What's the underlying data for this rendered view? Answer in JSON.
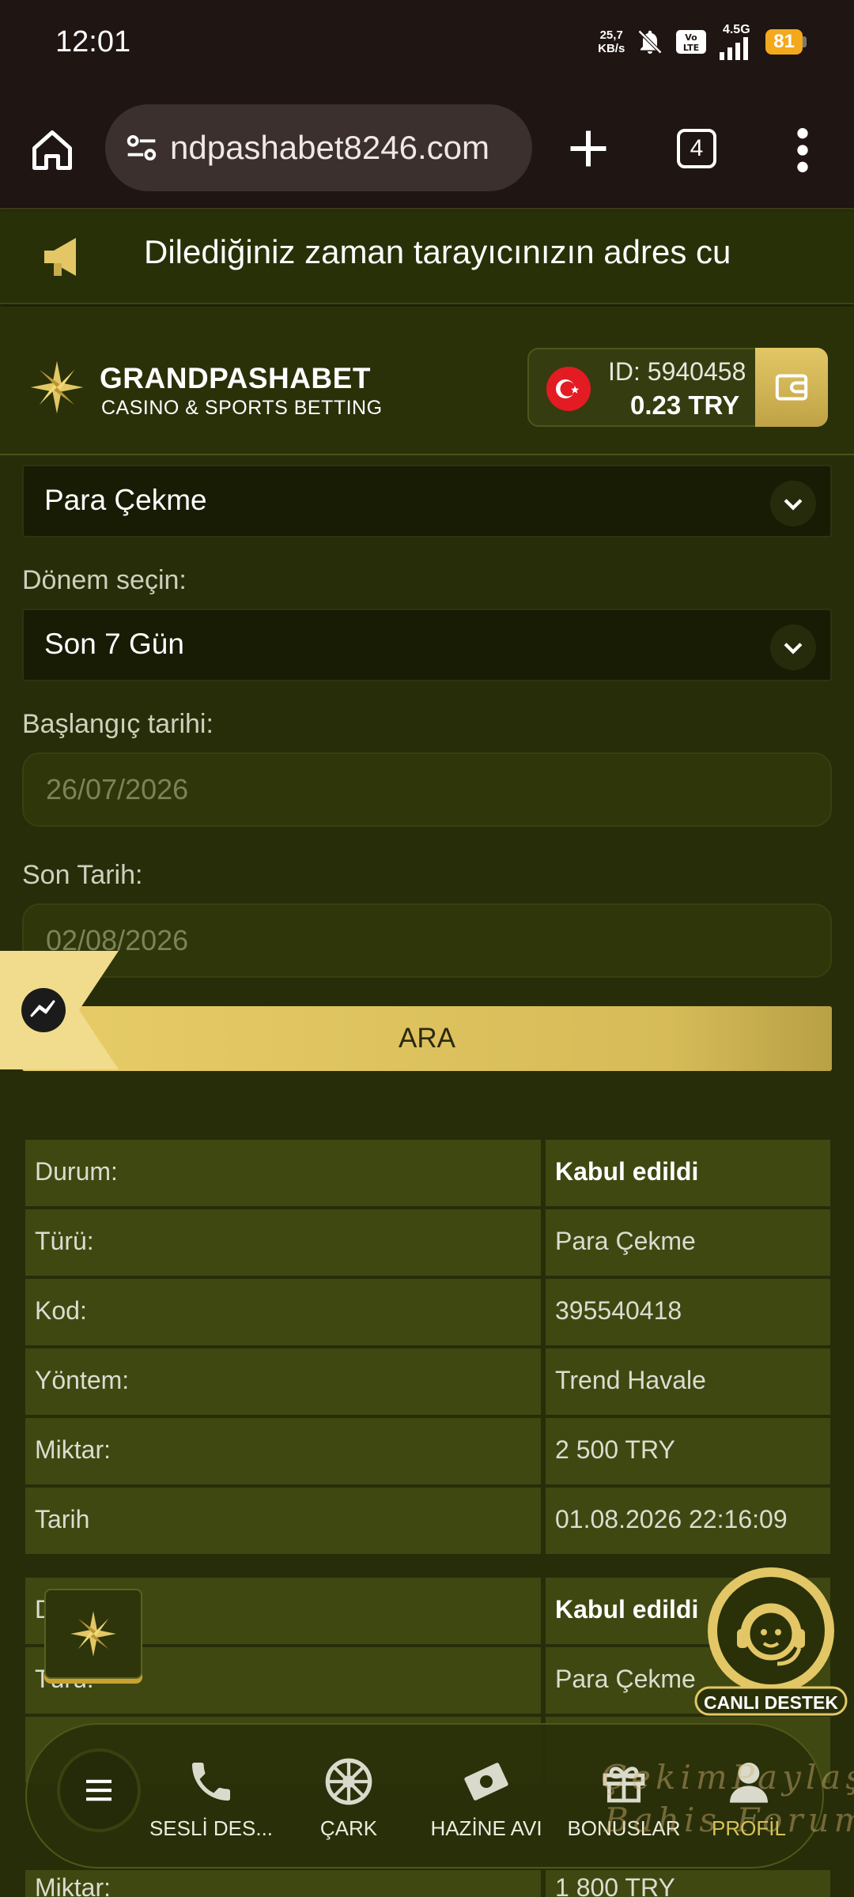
{
  "status_bar": {
    "time": "12:01",
    "net_speed_value": "25,7",
    "net_speed_unit": "KB/s",
    "network": "4.5G",
    "battery": "81"
  },
  "browser": {
    "url": "ndpashabet8246.com",
    "tab_count": "4"
  },
  "announcement": {
    "text": "Dilediğiniz zaman tarayıcınızın adres cu"
  },
  "header": {
    "brand": "GRANDPASHABET",
    "tagline": "CASINO & SPORTS BETTING",
    "account_id": "ID: 5940458",
    "balance": "0.23  TRY"
  },
  "form": {
    "type_select": "Para Çekme",
    "period_label": "Dönem seçin:",
    "period_select": "Son 7 Gün",
    "start_label": "Başlangıç tarihi:",
    "start_placeholder": "26/07/2026",
    "end_label": "Son Tarih:",
    "end_placeholder": "02/08/2026",
    "search_button": "ARA"
  },
  "transactions": [
    {
      "rows": [
        {
          "label": "Durum:",
          "value": "Kabul edildi"
        },
        {
          "label": "Türü:",
          "value": "Para Çekme"
        },
        {
          "label": "Kod:",
          "value": "395540418"
        },
        {
          "label": "Yöntem:",
          "value": "Trend Havale"
        },
        {
          "label": "Miktar:",
          "value": "2 500 TRY"
        },
        {
          "label": "Tarih",
          "value": "01.08.2026 22:16:09"
        }
      ]
    },
    {
      "rows": [
        {
          "label": "D",
          "value": "Kabul edildi"
        },
        {
          "label": "Türü:",
          "value": "Para Çekme"
        },
        {
          "label": "Miktar:",
          "value": "1 800 TRY"
        }
      ]
    }
  ],
  "live_support": "CANLI DESTEK",
  "bottom_nav": {
    "items": [
      {
        "label": "SESLİ DES...",
        "icon": "phone-icon"
      },
      {
        "label": "ÇARK",
        "icon": "wheel-icon"
      },
      {
        "label": "HAZİNE AVI",
        "icon": "money-icon"
      },
      {
        "label": "BONUSLAR",
        "icon": "gift-icon"
      },
      {
        "label": "PROFİL",
        "icon": "user-icon"
      }
    ]
  },
  "watermark": {
    "line1": "ÇekimPaylaş",
    "line2": "Bahis Forum"
  },
  "colors": {
    "background": "#272d09",
    "accent_gold": "#e3c766",
    "panel": "#3f4811"
  }
}
